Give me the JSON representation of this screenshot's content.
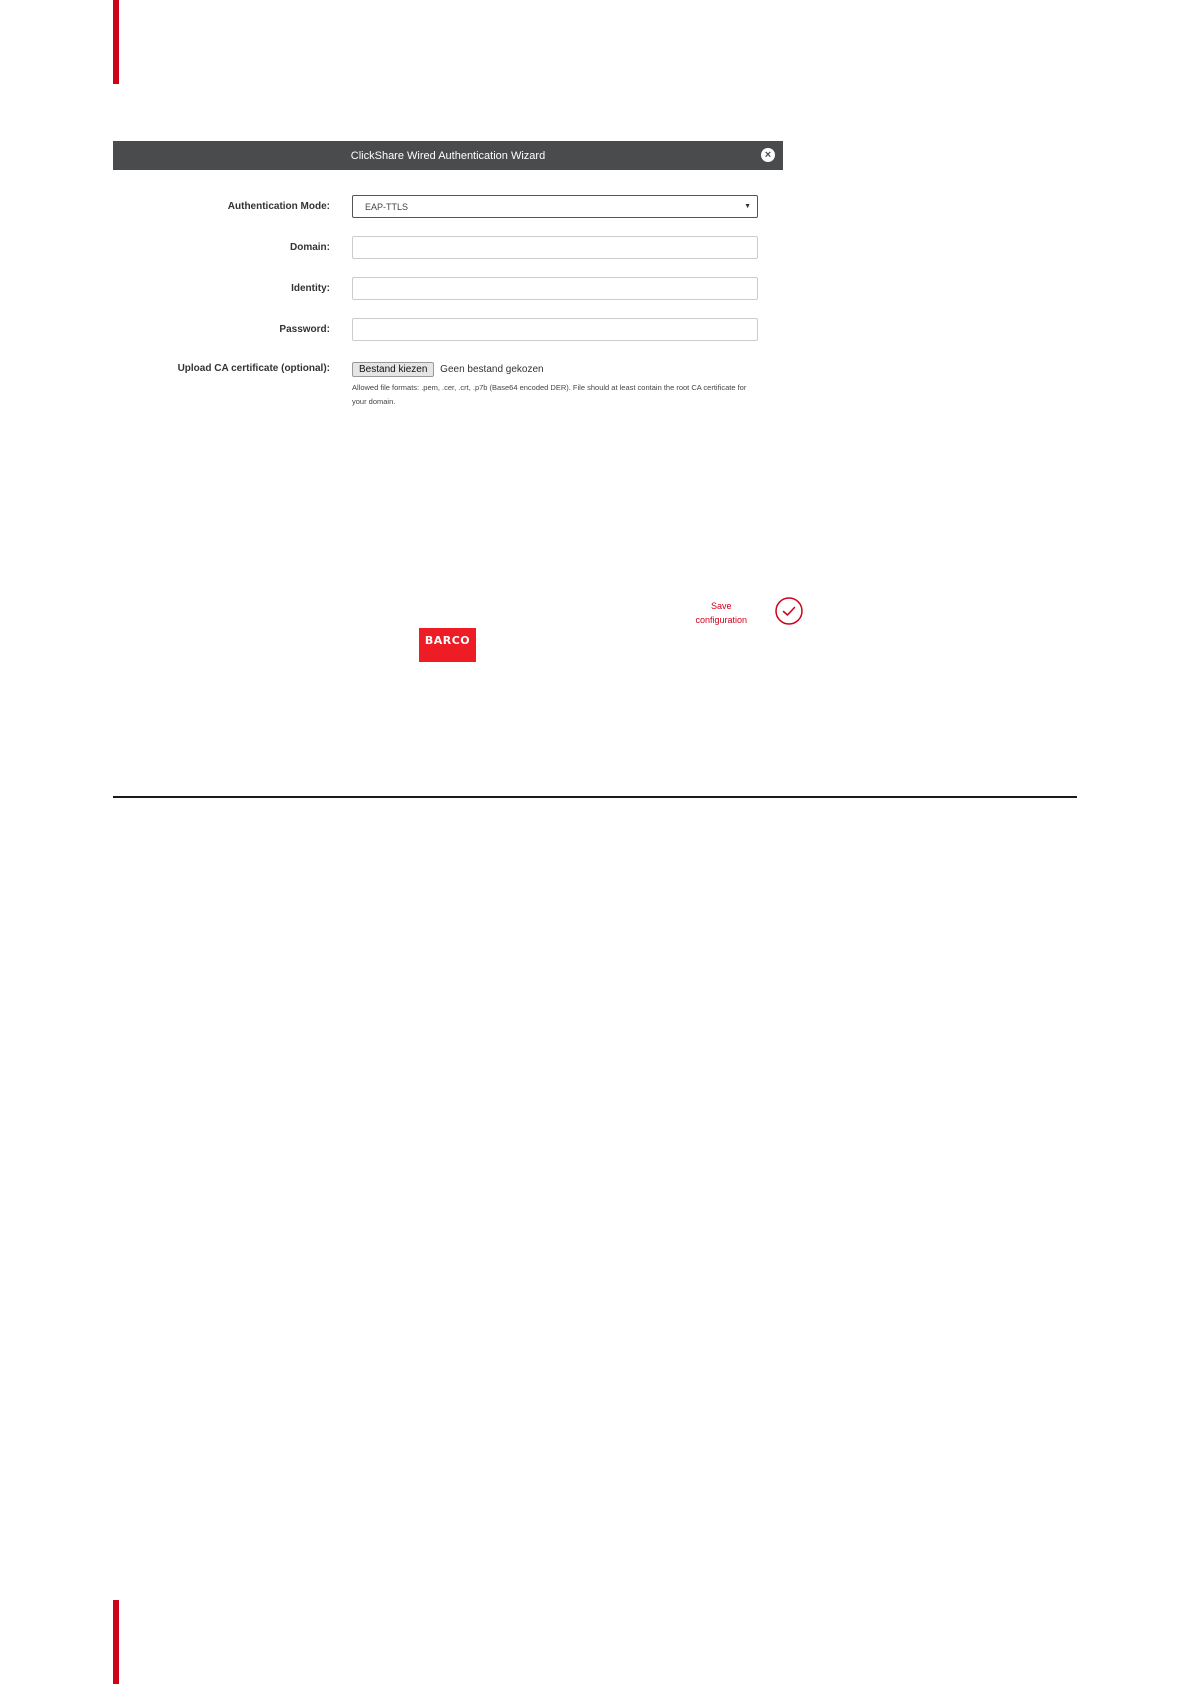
{
  "wizard": {
    "title": "ClickShare Wired Authentication Wizard",
    "close_icon": "close-icon"
  },
  "form": {
    "auth_mode_label": "Authentication Mode:",
    "auth_mode_value": "EAP-TTLS",
    "domain_label": "Domain:",
    "domain_value": "",
    "identity_label": "Identity:",
    "identity_value": "",
    "password_label": "Password:",
    "password_value": "",
    "upload_label": "Upload CA certificate (optional):",
    "file_button": "Bestand kiezen",
    "file_status": "Geen bestand gekozen",
    "file_hint": "Allowed file formats: .pem, .cer, .crt, .p7b (Base64 encoded DER). File should at least contain the root CA certificate for your domain."
  },
  "save": {
    "label_line1": "Save",
    "label_line2": "configuration",
    "icon": "check-circle-icon"
  },
  "brand": {
    "logo_text": "BARCO",
    "color": "#ee1c24"
  },
  "colors": {
    "accent": "#d0021b",
    "titlebar": "#4a4b4c"
  }
}
